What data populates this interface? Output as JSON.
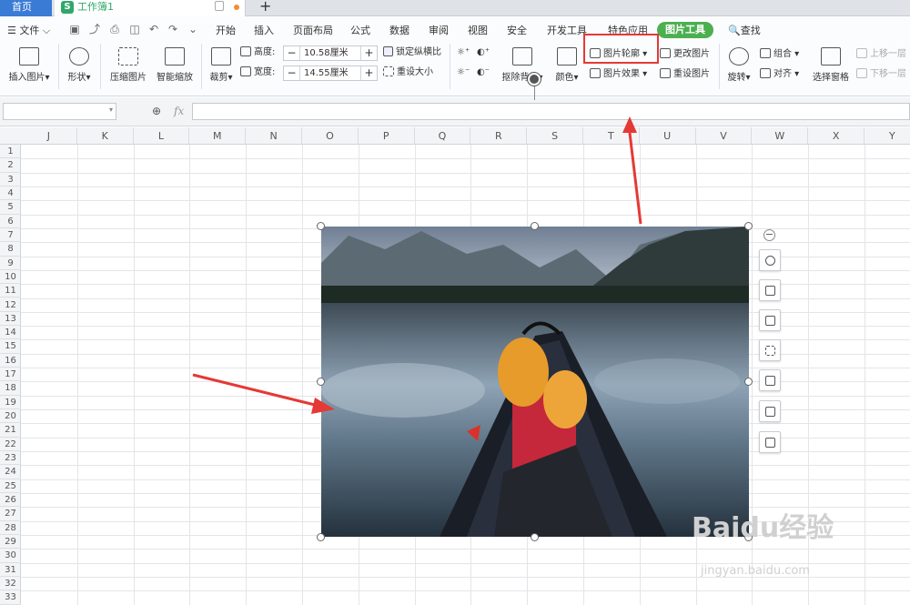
{
  "tabs": {
    "home": "首页",
    "doc": "工作簿1",
    "new": "+"
  },
  "menu": {
    "file": "文件",
    "items": [
      "开始",
      "插入",
      "页面布局",
      "公式",
      "数据",
      "审阅",
      "视图",
      "安全",
      "开发工具",
      "特色应用"
    ],
    "active": "图片工具",
    "search": "查找"
  },
  "ribbon": {
    "insert_picture": "插入图片",
    "shape": "形状",
    "compress": "压缩图片",
    "smart_zoom": "智能缩放",
    "crop": "裁剪",
    "height_label": "高度:",
    "height_value": "10.58厘米",
    "width_label": "宽度:",
    "width_value": "14.55厘米",
    "lock_ratio": "锁定纵横比",
    "reset_size": "重设大小",
    "remove_bg": "抠除背景",
    "color": "颜色",
    "outline": "图片轮廓",
    "effect": "图片效果",
    "change_pic": "更改图片",
    "reset_pic": "重设图片",
    "rotate": "旋转",
    "group": "组合",
    "align": "对齐",
    "select_pane": "选择窗格",
    "up": "上移一层",
    "down": "下移一层"
  },
  "formula": {
    "fx": "fx"
  },
  "columns": [
    "J",
    "K",
    "L",
    "M",
    "N",
    "O",
    "P",
    "Q",
    "R",
    "S",
    "T",
    "U",
    "V",
    "W",
    "X",
    "Y"
  ],
  "rows": [
    "1",
    "2",
    "3",
    "4",
    "5",
    "6",
    "7",
    "8",
    "9",
    "10",
    "11",
    "12",
    "13",
    "14",
    "15",
    "16",
    "17",
    "18",
    "19",
    "20",
    "21",
    "22",
    "23",
    "24",
    "25",
    "26",
    "27",
    "28",
    "29",
    "30",
    "31",
    "32",
    "33"
  ],
  "watermark": {
    "main": "Baidu经验",
    "sub": "jingyan.baidu.com"
  },
  "colors": {
    "accent": "#4caf50",
    "highlight": "#e53935",
    "tab_active": "#3a7bd5"
  }
}
